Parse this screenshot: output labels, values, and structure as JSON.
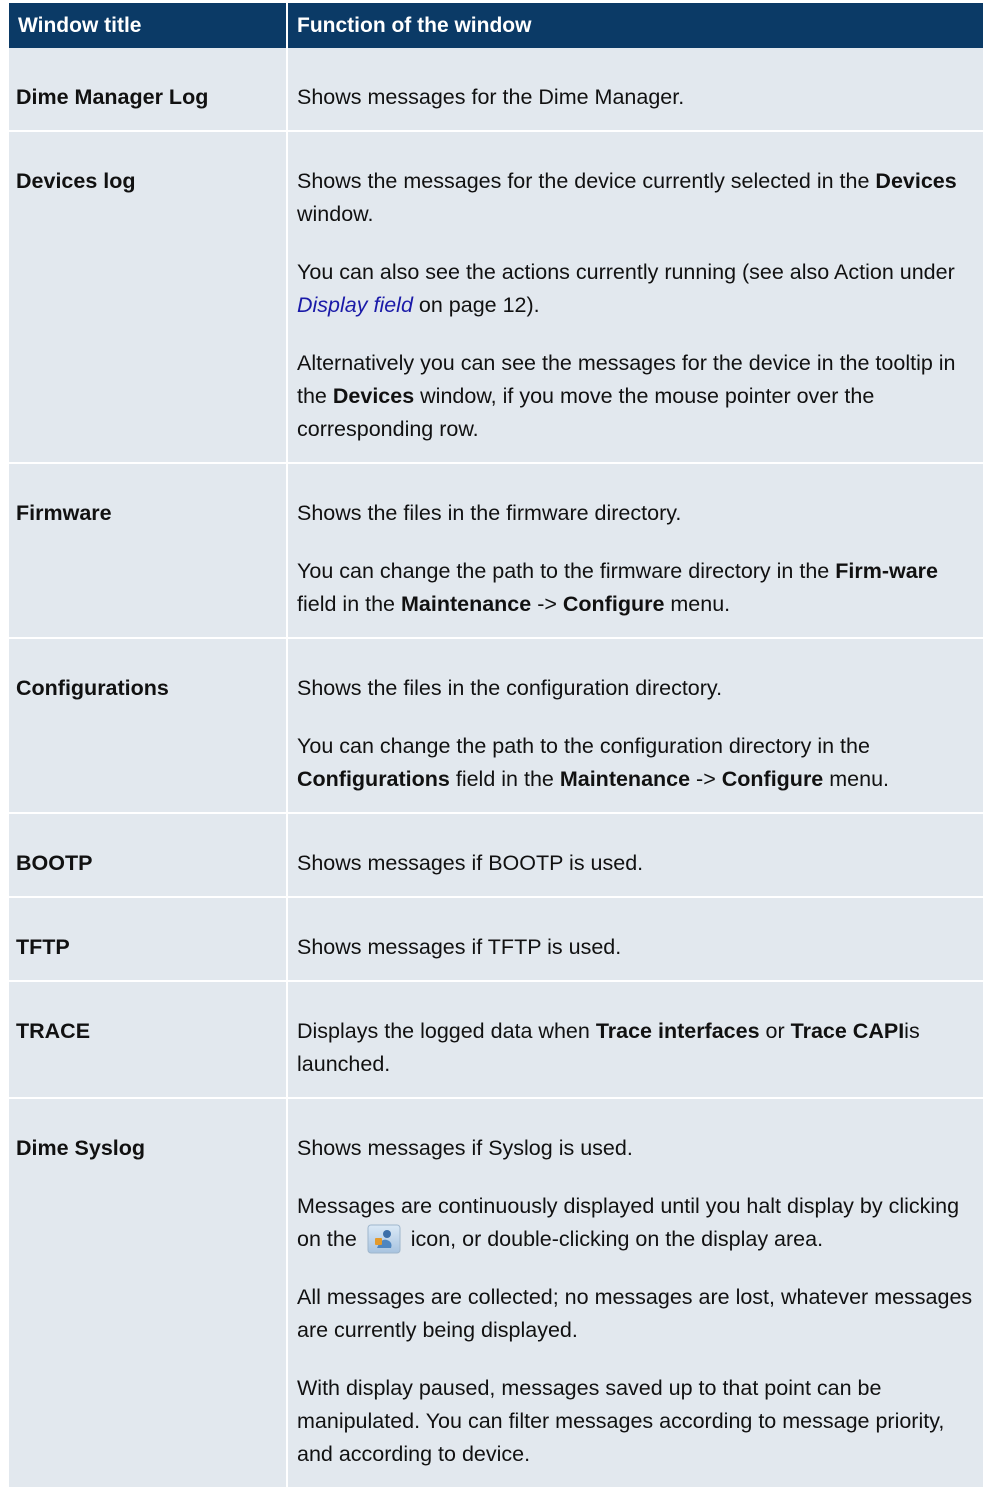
{
  "table": {
    "headers": [
      "Window title",
      "Function of the window"
    ],
    "rows": [
      {
        "title": "Dime Manager Log",
        "paragraphs": [
          {
            "text": "Shows messages for the Dime Manager."
          }
        ]
      },
      {
        "title": "Devices log",
        "paragraphs": [
          {
            "a": "Shows the messages for the device currently selected in the ",
            "b": "Devices",
            "c": " window."
          },
          {
            "a": "You can also see the actions currently running (see also Action under ",
            "link": "Display field",
            "c": " on page 12)."
          },
          {
            "a": "Alternatively you can see the messages for the device in the tooltip in the ",
            "b": "Devices",
            "c": " window, if you move the mouse pointer over the corresponding row."
          }
        ]
      },
      {
        "title": "Firmware",
        "paragraphs": [
          {
            "text": "Shows the files in the firmware directory."
          },
          {
            "a": "You can change the path to the firmware directory in the ",
            "b": "Firm-ware",
            "c": " field in the ",
            "d": "Maintenance",
            "e": " -> ",
            "f": "Configure",
            "g": " menu."
          }
        ]
      },
      {
        "title": "Configurations",
        "paragraphs": [
          {
            "text": "Shows the files in the configuration directory."
          },
          {
            "a": "You can change the path to the configuration directory in the ",
            "b": "Configurations",
            "c": " field in the ",
            "d": "Maintenance",
            "e": " -> ",
            "f": "Configure",
            "g": " menu."
          }
        ]
      },
      {
        "title": "BOOTP",
        "paragraphs": [
          {
            "text": "Shows messages if BOOTP is used."
          }
        ]
      },
      {
        "title": "TFTP",
        "paragraphs": [
          {
            "text": "Shows messages if TFTP is used."
          }
        ]
      },
      {
        "title": "TRACE",
        "paragraphs": [
          {
            "a": "Displays the logged data when ",
            "b": "Trace interfaces",
            "c": " or ",
            "d": "Trace CAPI",
            "e": "is launched."
          }
        ]
      },
      {
        "title": "Dime Syslog",
        "paragraphs": [
          {
            "text": "Shows messages if Syslog is used."
          },
          {
            "a": "Messages are continuously displayed until you halt display by clicking on the ",
            "icon": "halt-display-icon",
            "c": " icon, or double-clicking on the display area."
          },
          {
            "text": "All messages are collected; no messages are lost, whatever messages are currently being displayed."
          },
          {
            "text": "With display paused, messages saved up to that point can be manipulated. You can filter messages according to message priority, and according to device."
          }
        ]
      }
    ]
  },
  "colors": {
    "header_bg": "#0b3a66",
    "header_text": "#ffffff",
    "cell_bg": "#e2e8ee",
    "link": "#1a1aa8"
  }
}
